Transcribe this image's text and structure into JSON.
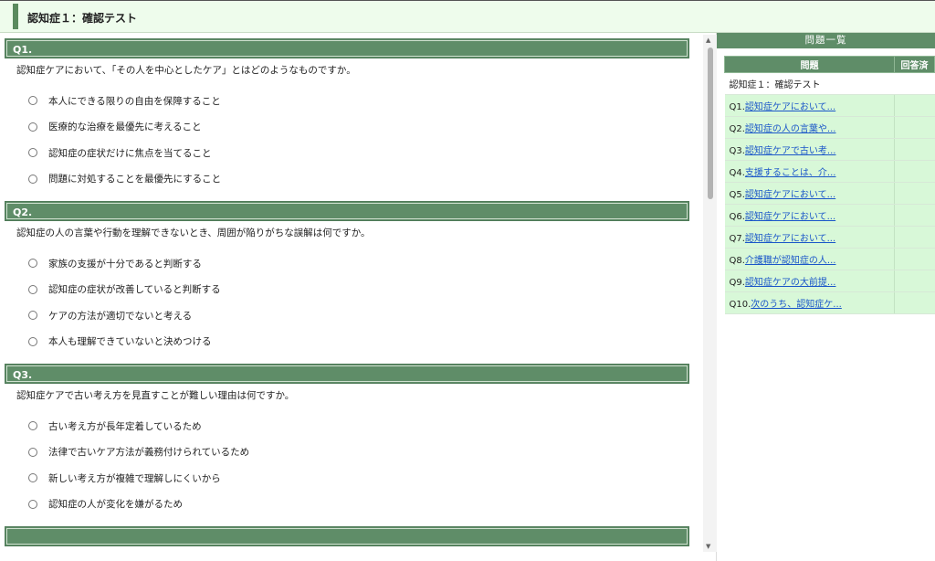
{
  "header": {
    "title": "認知症１：確認テスト"
  },
  "questions": [
    {
      "label": "Q1.",
      "text": "認知症ケアにおいて、「その人を中心としたケア」とはどのようなものですか。",
      "options": [
        "本人にできる限りの自由を保障すること",
        "医療的な治療を最優先に考えること",
        "認知症の症状だけに焦点を当てること",
        "問題に対処することを最優先にすること"
      ]
    },
    {
      "label": "Q2.",
      "text": "認知症の人の言葉や行動を理解できないとき、周囲が陥りがちな誤解は何ですか。",
      "options": [
        "家族の支援が十分であると判断する",
        "認知症の症状が改善していると判断する",
        "ケアの方法が適切でないと考える",
        "本人も理解できていないと決めつける"
      ]
    },
    {
      "label": "Q3.",
      "text": "認知症ケアで古い考え方を見直すことが難しい理由は何ですか。",
      "options": [
        "古い考え方が長年定着しているため",
        "法律で古いケア方法が義務付けられているため",
        "新しい考え方が複雑で理解しにくいから",
        "認知症の人が変化を嫌がるため"
      ]
    }
  ],
  "sidebar": {
    "title": "問題一覧",
    "col_question": "問題",
    "col_answered": "回答済",
    "test_name": "認知症１：確認テスト",
    "items": [
      {
        "num": "Q1.",
        "link": "認知症ケアにおいて..."
      },
      {
        "num": "Q2.",
        "link": "認知症の人の言葉や..."
      },
      {
        "num": "Q3.",
        "link": "認知症ケアで古い考..."
      },
      {
        "num": "Q4.",
        "link": "支援することは、介..."
      },
      {
        "num": "Q5.",
        "link": "認知症ケアにおいて..."
      },
      {
        "num": "Q6.",
        "link": "認知症ケアにおいて..."
      },
      {
        "num": "Q7.",
        "link": "認知症ケアにおいて..."
      },
      {
        "num": "Q8.",
        "link": "介護職が認知症の人..."
      },
      {
        "num": "Q9.",
        "link": "認知症ケアの大前提..."
      },
      {
        "num": "Q10.",
        "link": "次のうち、認知症ケ..."
      }
    ]
  },
  "colors": {
    "accent": "#5f8d68",
    "header_bg": "#eefcec",
    "row_bg": "#d8f8d8",
    "link": "#1a56c9"
  }
}
